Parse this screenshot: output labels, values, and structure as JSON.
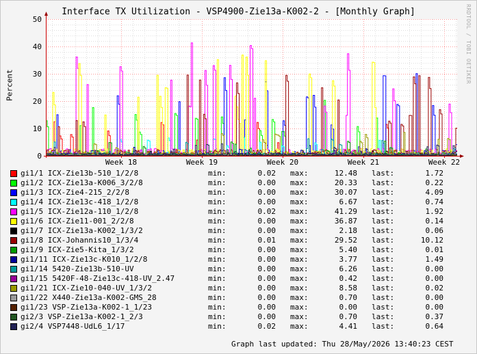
{
  "chart_data": {
    "type": "line",
    "title": "Interface TX Utilization - VSP4900-Zie13a-K002-2 - [Monthly Graph]",
    "ylabel": "Percent",
    "xlabel": "",
    "ylim": [
      0,
      50
    ],
    "yticks": [
      0,
      10,
      20,
      30,
      40,
      50
    ],
    "xticks": [
      "Week 18",
      "Week 19",
      "Week 20",
      "Week 21",
      "Week 22"
    ],
    "grid": true,
    "watermark": "RRDTOOL / TOBI OETIKER",
    "series": [
      {
        "name": "gi1/1 ICX-Zie13b-510_1/2/8",
        "color": "#ff0000",
        "min": "0.02",
        "max": "12.48",
        "last": "1.72"
      },
      {
        "name": "gi1/2 ICX-Zie13a-K006_3/2/8",
        "color": "#00ff00",
        "min": "0.00",
        "max": "20.33",
        "last": "0.22"
      },
      {
        "name": "gi1/3 ICX-Zie4-215_2/2/8",
        "color": "#0000ff",
        "min": "0.00",
        "max": "30.07",
        "last": "4.09"
      },
      {
        "name": "gi1/4 ICX-Zie13c-418_1/2/8",
        "color": "#00ffff",
        "min": "0.00",
        "max": "6.67",
        "last": "0.74"
      },
      {
        "name": "gi1/5 ICX-Zie12a-110_1/2/8",
        "color": "#ff00ff",
        "min": "0.02",
        "max": "41.29",
        "last": "1.92"
      },
      {
        "name": "gi1/6 ICX-Zie11-001_2/2/8",
        "color": "#ffff00",
        "min": "0.00",
        "max": "36.87",
        "last": "0.14"
      },
      {
        "name": "gi1/7 ICX-Zie13a-K002_1/3/2",
        "color": "#000000",
        "min": "0.00",
        "max": "2.18",
        "last": "0.06"
      },
      {
        "name": "gi1/8 ICX-Johannis10_1/3/4",
        "color": "#990000",
        "min": "0.01",
        "max": "29.52",
        "last": "10.12"
      },
      {
        "name": "gi1/9 ICX-Zie5-Kita_1/3/2",
        "color": "#009900",
        "min": "0.00",
        "max": "5.40",
        "last": "0.01"
      },
      {
        "name": "gi1/11 ICX-Zie13c-K010_1/2/8",
        "color": "#000099",
        "min": "0.00",
        "max": "3.77",
        "last": "1.49"
      },
      {
        "name": "gi1/14 5420-Zie13b-510-UV",
        "color": "#009999",
        "min": "0.00",
        "max": "6.26",
        "last": "0.00"
      },
      {
        "name": "gi1/15 5420F-48-Zie13c-418-UV_2.47",
        "color": "#990099",
        "min": "0.00",
        "max": "0.42",
        "last": "0.00"
      },
      {
        "name": "gi1/21 ICX-Zie10-040-UV_1/3/2",
        "color": "#999900",
        "min": "0.00",
        "max": "8.58",
        "last": "0.02"
      },
      {
        "name": "gi1/22 X440-Zie13a-K002-GMS_28",
        "color": "#999999",
        "min": "0.00",
        "max": "0.70",
        "last": "0.00"
      },
      {
        "name": "gi1/23 VSP-Zie13a-K002-1_1/23",
        "color": "#552200",
        "min": "0.00",
        "max": "0.00",
        "last": "0.00"
      },
      {
        "name": "gi2/3 VSP-Zie13a-K002-1_2/3",
        "color": "#225522",
        "min": "0.00",
        "max": "0.70",
        "last": "0.37"
      },
      {
        "name": "gi2/4 VSP7448-UdL6_1/17",
        "color": "#222255",
        "min": "0.02",
        "max": "4.41",
        "last": "0.64"
      }
    ]
  },
  "legend": {
    "min_label": "min:",
    "max_label": "max:",
    "last_label": "last:"
  },
  "footer": {
    "updated": "Graph last updated: Thu 28/May/2026 13:40:23 CEST"
  }
}
